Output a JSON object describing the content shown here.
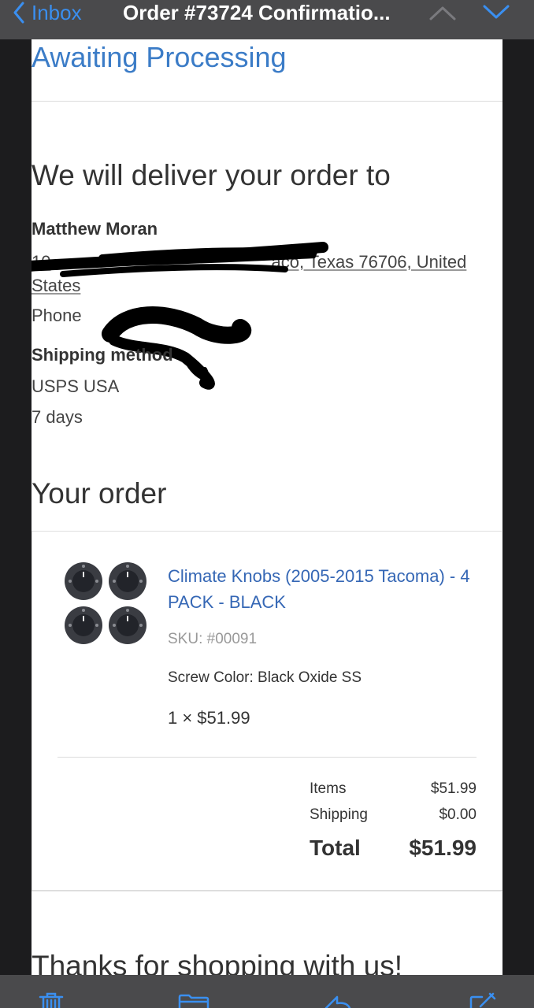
{
  "navbar": {
    "back_label": "Inbox",
    "title": "Order #73724 Confirmatio...",
    "accent": "#3a8ff0"
  },
  "email": {
    "status": "Awaiting Processing",
    "deliver_heading": "We will deliver your order to",
    "customer_name": "Matthew Moran",
    "address_line1_visible_start": "10",
    "address_line1_visible_end": "aco, Texas 76706, United",
    "address_line2": "States",
    "phone_label": "Phone",
    "shipping_title": "Shipping method",
    "shipping_method": "USPS USA",
    "shipping_time": "7 days",
    "your_order_heading": "Your order",
    "product": {
      "name": "Climate Knobs (2005-2015 Tacoma) - 4 PACK - BLACK",
      "sku": "SKU: #00091",
      "option": "Screw Color: Black Oxide SS",
      "quantity_price": "1 × $51.99"
    },
    "summary": {
      "items_label": "Items",
      "items_value": "$51.99",
      "shipping_label": "Shipping",
      "shipping_value": "$0.00",
      "total_label": "Total",
      "total_value": "$51.99"
    },
    "thanks": "Thanks for shopping with us!"
  },
  "toolbar": {
    "icons": [
      "trash-icon",
      "folder-icon",
      "reply-icon",
      "compose-icon"
    ]
  }
}
